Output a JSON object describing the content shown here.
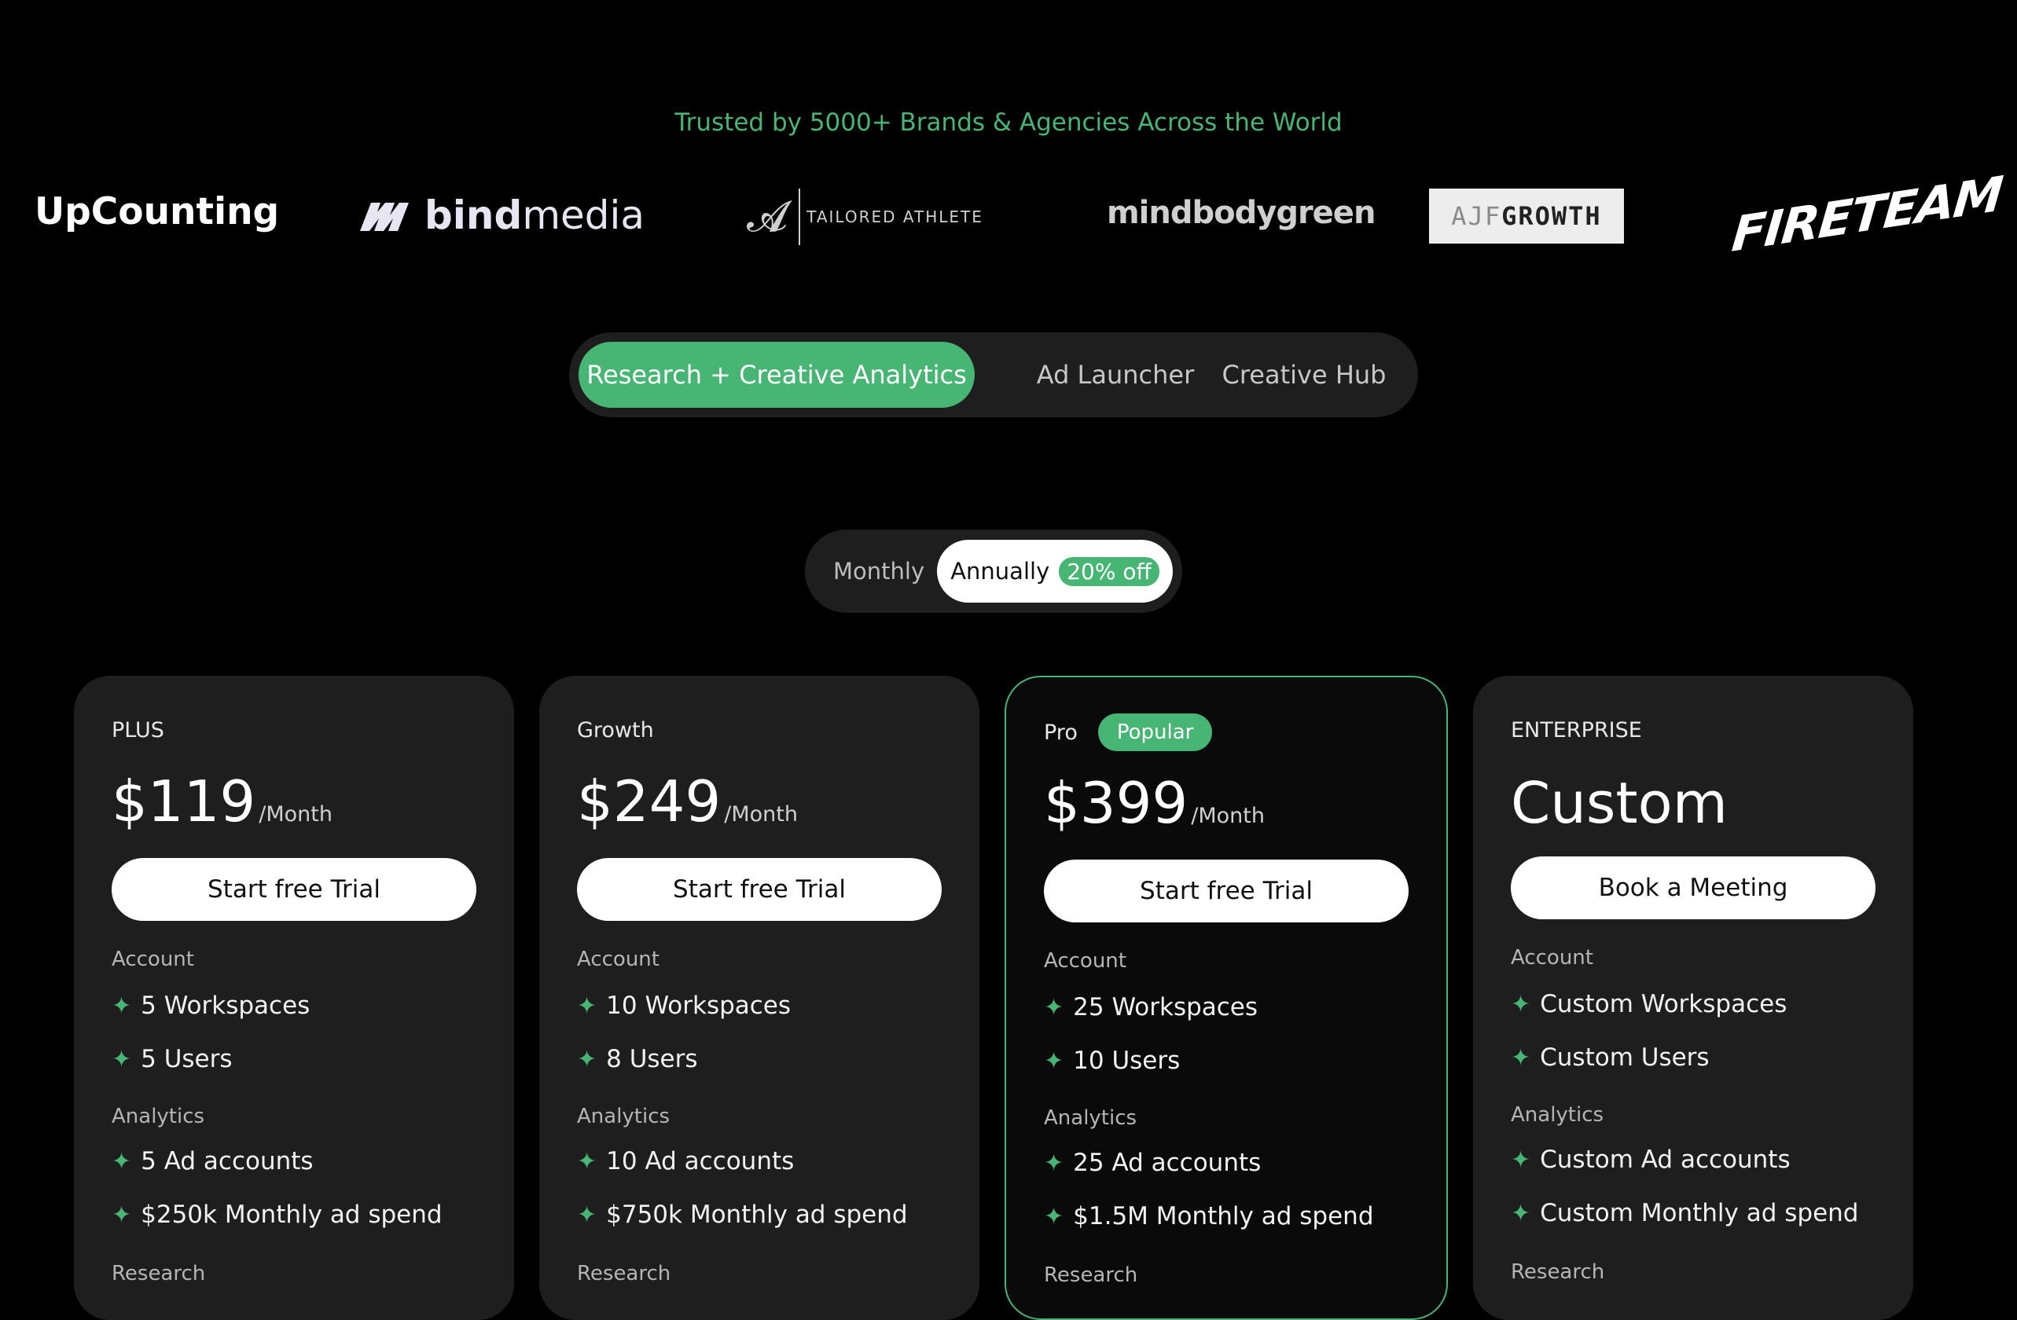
{
  "trusted_text": "Trusted by 5000+ Brands & Agencies Across the World",
  "logos": {
    "upcounting": "UpCounting",
    "bindmedia_bold": "bind",
    "bindmedia_light": "media",
    "tailored_athlete": "TAILORED ATHLETE",
    "mindbodygreen": "mindbodygreen",
    "ajf_light": "AJF",
    "ajf_bold": "GROWTH",
    "fireteam": "FIRETEAM"
  },
  "product_tabs": [
    {
      "label": "Research + Creative Analytics",
      "active": true
    },
    {
      "label": "Ad Launcher",
      "active": false
    },
    {
      "label": "Creative Hub",
      "active": false
    }
  ],
  "billing": {
    "monthly_label": "Monthly",
    "annually_label": "Annually",
    "discount_badge": "20% off",
    "selected": "Annually"
  },
  "plans": [
    {
      "tier": "PLUS",
      "price": "$119",
      "per": "/Month",
      "cta": "Start free Trial",
      "account_label": "Account",
      "account_features": [
        "5 Workspaces",
        "5 Users"
      ],
      "analytics_label": "Analytics",
      "analytics_features": [
        "5 Ad accounts",
        "$250k Monthly ad spend"
      ],
      "research_label": "Research"
    },
    {
      "tier": "Growth",
      "price": "$249",
      "per": "/Month",
      "cta": "Start free Trial",
      "account_label": "Account",
      "account_features": [
        "10 Workspaces",
        "8 Users"
      ],
      "analytics_label": "Analytics",
      "analytics_features": [
        "10 Ad accounts",
        "$750k Monthly ad spend"
      ],
      "research_label": "Research"
    },
    {
      "tier": "Pro",
      "badge": "Popular",
      "price": "$399",
      "per": "/Month",
      "cta": "Start free Trial",
      "account_label": "Account",
      "account_features": [
        "25 Workspaces",
        "10 Users"
      ],
      "analytics_label": "Analytics",
      "analytics_features": [
        "25 Ad accounts",
        "$1.5M Monthly ad spend"
      ],
      "research_label": "Research"
    },
    {
      "tier": "ENTERPRISE",
      "price": "Custom",
      "cta": "Book a Meeting",
      "account_label": "Account",
      "account_features": [
        "Custom Workspaces",
        "Custom Users"
      ],
      "analytics_label": "Analytics",
      "analytics_features": [
        "Custom Ad accounts",
        "Custom Monthly ad spend"
      ],
      "research_label": "Research"
    }
  ],
  "colors": {
    "accent": "#47b574",
    "background": "#000000",
    "card": "#1e1e1e"
  },
  "icons": {
    "feature_bullet": "four-point-star-icon"
  }
}
